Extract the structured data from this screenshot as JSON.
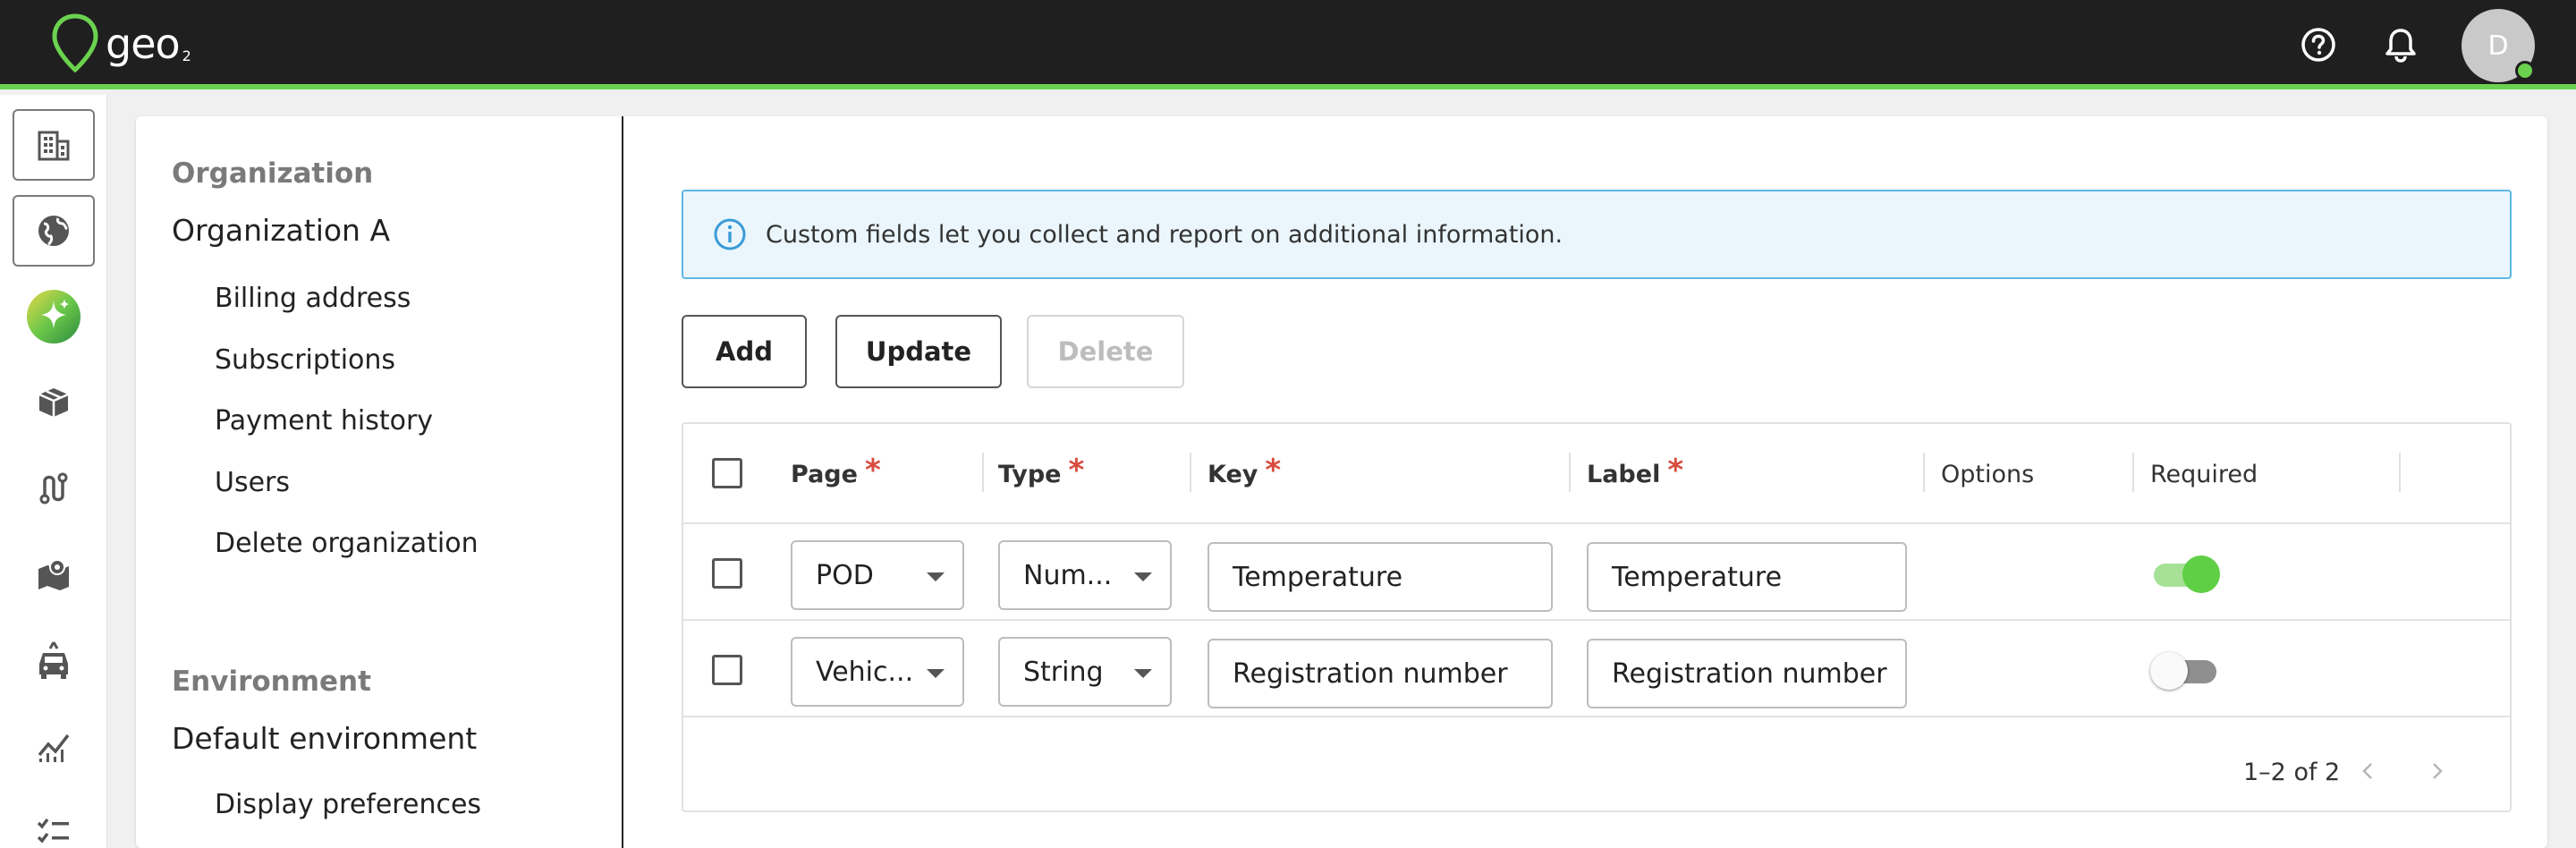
{
  "app": {
    "logo_text": "geo",
    "logo_sub": "2"
  },
  "topbar": {
    "help_icon": "help-circle-icon",
    "notifications_icon": "bell-icon",
    "avatar_initial": "D",
    "avatar_status_color": "#6bd24f"
  },
  "rail": {
    "items": [
      {
        "icon": "building-icon",
        "selected": true
      },
      {
        "icon": "globe-icon",
        "selected": true
      },
      {
        "icon": "sparkle-logo-icon",
        "selected": false
      },
      {
        "icon": "package-icon",
        "selected": false
      },
      {
        "icon": "route-icon",
        "selected": false
      },
      {
        "icon": "map-pin-icon",
        "selected": false
      },
      {
        "icon": "vehicle-icon",
        "selected": false
      },
      {
        "icon": "analytics-icon",
        "selected": false
      },
      {
        "icon": "checklist-icon",
        "selected": false
      }
    ]
  },
  "nav": {
    "org_section": "Organization",
    "org_name": "Organization A",
    "org_items": [
      "Billing address",
      "Subscriptions",
      "Payment history",
      "Users",
      "Delete organization"
    ],
    "env_section": "Environment",
    "env_name": "Default environment",
    "env_items": [
      "Display preferences"
    ]
  },
  "banner": {
    "text": "Custom fields let you collect and report on additional information.",
    "icon": "info-icon"
  },
  "toolbar": {
    "add": "Add",
    "update": "Update",
    "delete": "Delete",
    "delete_disabled": true
  },
  "table": {
    "columns": {
      "page": "Page",
      "type": "Type",
      "key": "Key",
      "label": "Label",
      "options": "Options",
      "required": "Required",
      "required_marker": "*"
    },
    "rows": [
      {
        "page": "POD",
        "type": "Num...",
        "key": "Temperature",
        "label": "Temperature",
        "required": true,
        "checked": false
      },
      {
        "page": "Vehic...",
        "type": "String",
        "key": "Registration number",
        "label": "Registration number",
        "required": false,
        "checked": false
      }
    ],
    "pagination": {
      "text": "1–2 of 2",
      "prev_icon": "chevron-left-icon",
      "next_icon": "chevron-right-icon"
    }
  },
  "colors": {
    "accent_green": "#6bd24f",
    "info_border": "#5db8e6",
    "info_bg": "#eaf6fc",
    "required_red": "#d94b3f"
  }
}
